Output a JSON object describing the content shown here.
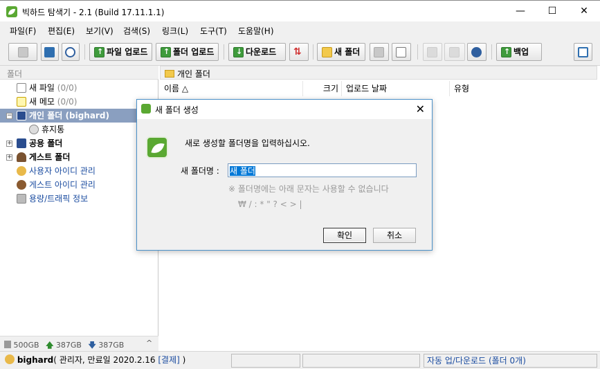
{
  "window": {
    "title": "빅하드 탐색기 - 2.1 (Build 17.11.1.1)",
    "minimize": "—",
    "maximize": "☐",
    "close": "✕"
  },
  "menu": [
    "파일(F)",
    "편집(E)",
    "보기(V)",
    "검색(S)",
    "링크(L)",
    "도구(T)",
    "도움말(H)"
  ],
  "toolbar": {
    "upload_file": "파일 업로드",
    "upload_folder": "폴더 업로드",
    "download": "다운로드",
    "new_folder": "새 폴더",
    "backup": "백업"
  },
  "folder_pane": {
    "header": "폴더",
    "items": {
      "new_files": "새 파일",
      "new_files_count": "(0/0)",
      "new_memo": "새 메모",
      "new_memo_count": "(0/0)",
      "personal": "개인 폴더 (bighard)",
      "trash": "휴지통",
      "public": "공용 폴더",
      "guest": "게스트 폴더",
      "user_id_mgmt": "사용자 아이디 관리",
      "guest_id_mgmt": "게스트 아이디 관리",
      "capacity": "용량/트래픽 정보"
    },
    "footer": {
      "total": "500GB",
      "up": "387GB",
      "down": "387GB"
    }
  },
  "file_pane": {
    "path": "개인 폴더",
    "columns": {
      "name": "이름 △",
      "size": "크기",
      "date": "업로드 날짜",
      "type": "유형"
    }
  },
  "status": {
    "user": "bighard",
    "info": "( 관리자, 만료일 2020.2.16 ",
    "payment": "[결제]",
    "close_paren": " )",
    "auto": "자동 업/다운로드 (폴더 0개)"
  },
  "dialog": {
    "title": "새 폴더 생성",
    "close": "✕",
    "prompt": "새로 생성할 폴더명을 입력하십시오.",
    "label": "새 폴더명 :",
    "value": "새 폴더",
    "warning": "※ 폴더명에는 아래 문자는 사용할 수 없습니다",
    "chars": "₩ / : * \" ? < > |",
    "ok": "확인",
    "cancel": "취소"
  },
  "colors": {
    "brand": "#5aa832",
    "selection": "#8a9fc0",
    "link": "#1b4ca0",
    "accent_border": "#4a90c8"
  }
}
